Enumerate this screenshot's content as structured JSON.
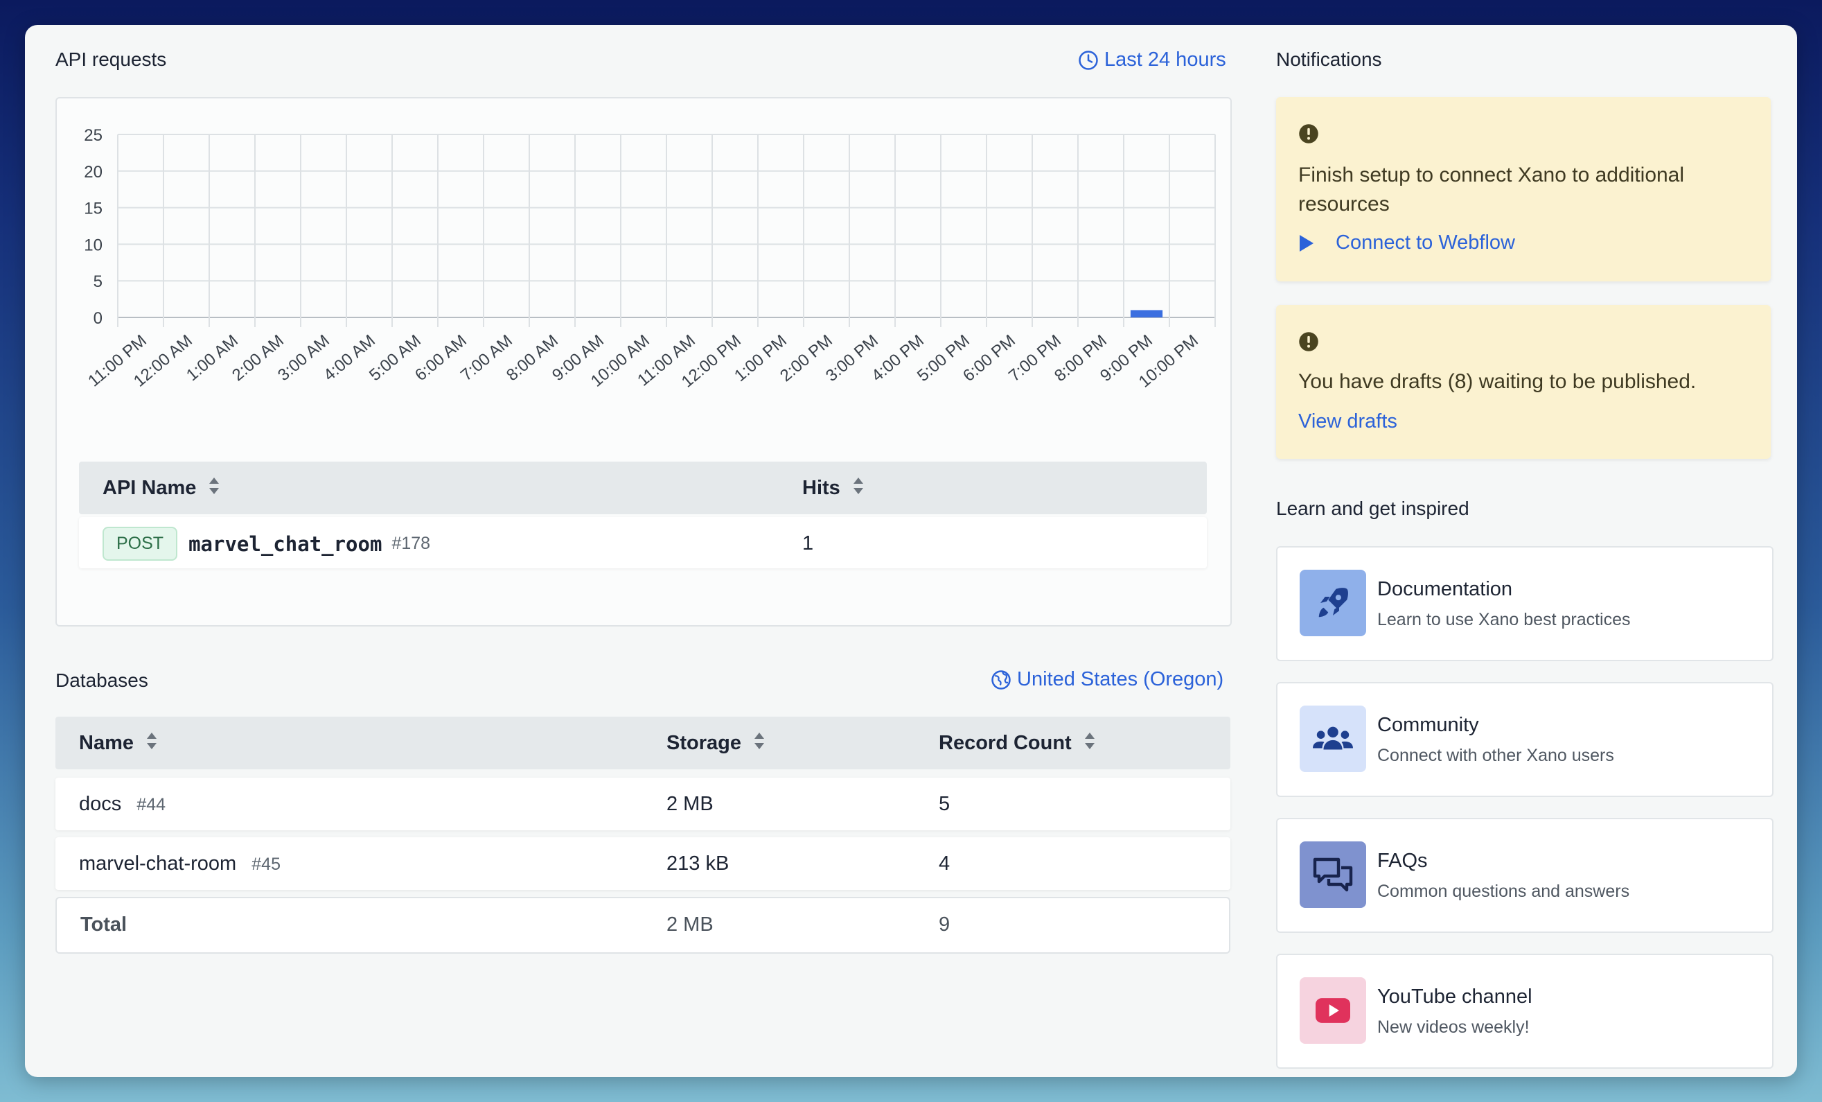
{
  "api_requests": {
    "title": "API requests",
    "range_label": "Last 24 hours"
  },
  "chart_data": {
    "type": "bar",
    "categories": [
      "11:00 PM",
      "12:00 AM",
      "1:00 AM",
      "2:00 AM",
      "3:00 AM",
      "4:00 AM",
      "5:00 AM",
      "6:00 AM",
      "7:00 AM",
      "8:00 AM",
      "9:00 AM",
      "10:00 AM",
      "11:00 AM",
      "12:00 PM",
      "1:00 PM",
      "2:00 PM",
      "3:00 PM",
      "4:00 PM",
      "5:00 PM",
      "6:00 PM",
      "7:00 PM",
      "8:00 PM",
      "9:00 PM",
      "10:00 PM"
    ],
    "values": [
      0,
      0,
      0,
      0,
      0,
      0,
      0,
      0,
      0,
      0,
      0,
      0,
      0,
      0,
      0,
      0,
      0,
      0,
      0,
      0,
      0,
      0,
      1,
      0
    ],
    "ylim": [
      0,
      25
    ],
    "yticks": [
      0,
      5,
      10,
      15,
      20,
      25
    ],
    "grid": true,
    "bar_color": "#3b6fe0"
  },
  "api_table": {
    "headers": {
      "name": "API Name",
      "hits": "Hits"
    },
    "rows": [
      {
        "method": "POST",
        "name": "marvel_chat_room",
        "id": "#178",
        "hits": "1"
      }
    ]
  },
  "databases": {
    "title": "Databases",
    "region": "United States (Oregon)",
    "headers": {
      "name": "Name",
      "storage": "Storage",
      "records": "Record Count"
    },
    "rows": [
      {
        "name": "docs",
        "id": "#44",
        "storage": "2 MB",
        "records": "5"
      },
      {
        "name": "marvel-chat-room",
        "id": "#45",
        "storage": "213 kB",
        "records": "4"
      }
    ],
    "total": {
      "label": "Total",
      "storage": "2 MB",
      "records": "9"
    }
  },
  "notifications": {
    "title": "Notifications",
    "items": [
      {
        "text": "Finish setup to connect Xano to additional resources",
        "link": "Connect to Webflow"
      },
      {
        "text": "You have drafts (8) waiting to be published.",
        "link": "View drafts"
      }
    ]
  },
  "learn": {
    "title": "Learn and get inspired",
    "items": [
      {
        "title": "Documentation",
        "subtitle": "Learn to use Xano best practices",
        "icon": "rocket-icon",
        "bg": "#8fb0ea",
        "color": "#1e3f8f"
      },
      {
        "title": "Community",
        "subtitle": "Connect with other Xano users",
        "icon": "users-icon",
        "bg": "#d6e2fa",
        "color": "#1e3f8f"
      },
      {
        "title": "FAQs",
        "subtitle": "Common questions and answers",
        "icon": "chat-bubbles-icon",
        "bg": "#7f92cf",
        "color": "#18234d"
      },
      {
        "title": "YouTube channel",
        "subtitle": "New videos weekly!",
        "icon": "youtube-icon",
        "bg": "#f6d3df",
        "color": "#e0325c"
      }
    ]
  },
  "colors": {
    "accent": "#2b62d9",
    "notice_bg": "#fbf2d0"
  }
}
